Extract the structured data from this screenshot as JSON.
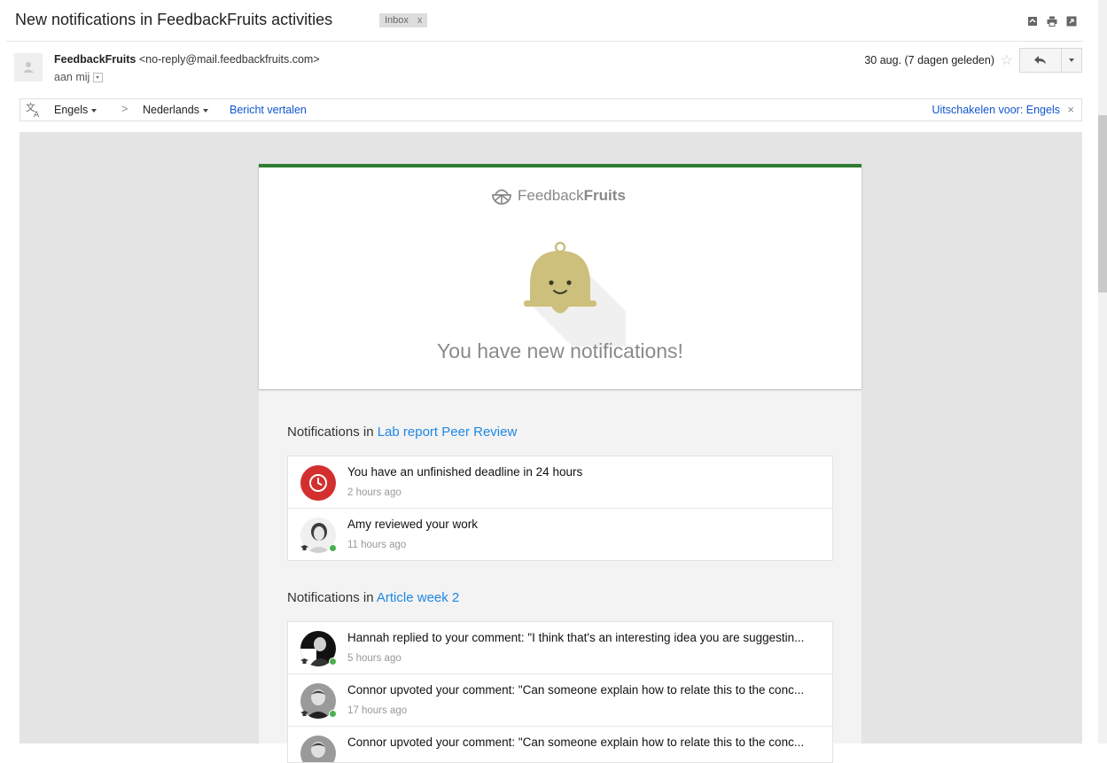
{
  "email": {
    "subject": "New notifications in FeedbackFruits activities",
    "label": "Inbox",
    "label_remove": "x",
    "sender_name": "FeedbackFruits",
    "sender_email": "<no-reply@mail.feedbackfruits.com>",
    "to": "aan mij",
    "date": "30 aug. (7 dagen geleden)"
  },
  "translate": {
    "source_lang": "Engels",
    "arrow": ">",
    "target_lang": "Nederlands",
    "translate_link": "Bericht vertalen",
    "disable_link": "Uitschakelen voor: Engels",
    "close": "×"
  },
  "body": {
    "logo_light": "Feedback",
    "logo_bold": "Fruits",
    "headline": "You have new notifications!",
    "sections": [
      {
        "prefix": "Notifications in",
        "activity": "Lab report Peer Review",
        "items": [
          {
            "text": "You have an unfinished deadline in 24 hours",
            "time": "2 hours ago",
            "icon": "clock-icon"
          },
          {
            "text": "Amy reviewed your work",
            "time": "11 hours ago",
            "icon": "avatar"
          }
        ]
      },
      {
        "prefix": "Notifications in",
        "activity": "Article week 2",
        "items": [
          {
            "text": "Hannah replied to your comment:  \"I think that's an interesting idea you are suggestin...",
            "time": "5 hours ago",
            "icon": "avatar"
          },
          {
            "text": "Connor upvoted your comment:  \"Can someone explain how to relate this to the conc...",
            "time": "17 hours ago",
            "icon": "avatar"
          },
          {
            "text": "Connor upvoted your comment:  \"Can someone explain how to relate this to the conc...",
            "time": "",
            "icon": "avatar"
          }
        ]
      }
    ]
  },
  "colors": {
    "accent_green": "#2e7d32",
    "link_blue": "#1e88e5",
    "deadline_red": "#d32f2f",
    "bell": "#cdbf7c"
  }
}
